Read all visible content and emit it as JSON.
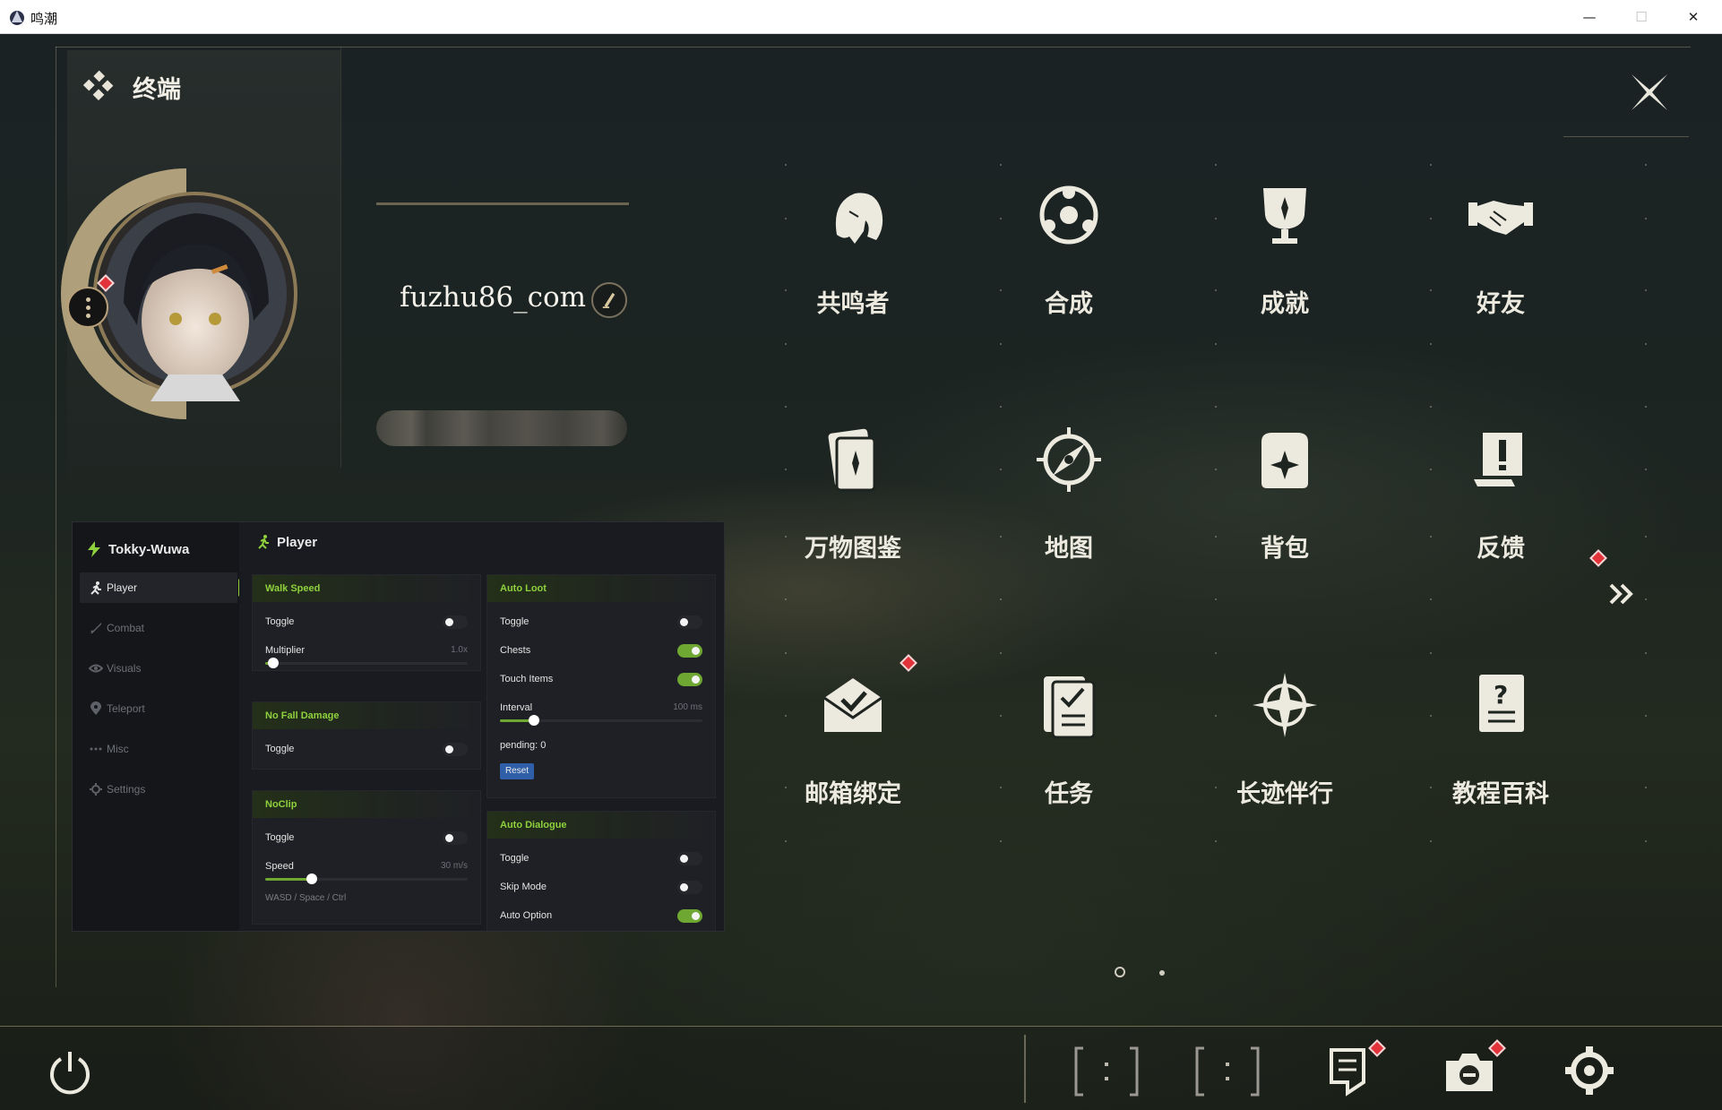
{
  "window": {
    "title": "鸣潮",
    "minimize": "—",
    "maximize": "☐",
    "close": "✕"
  },
  "header": {
    "title": "终端",
    "close_icon": "close-x-icon"
  },
  "profile": {
    "username": "fuzhu86_com"
  },
  "menu": {
    "items": [
      {
        "label": "共鸣者",
        "icon": "resonator-head-icon",
        "badge": false
      },
      {
        "label": "合成",
        "icon": "synthesis-icon",
        "badge": false
      },
      {
        "label": "成就",
        "icon": "trophy-icon",
        "badge": false
      },
      {
        "label": "好友",
        "icon": "handshake-icon",
        "badge": false
      },
      {
        "label": "万物图鉴",
        "icon": "card-book-icon",
        "badge": false
      },
      {
        "label": "地图",
        "icon": "compass-icon",
        "badge": false
      },
      {
        "label": "背包",
        "icon": "backpack-icon",
        "badge": false
      },
      {
        "label": "反馈",
        "icon": "feedback-icon",
        "badge": false
      },
      {
        "label": "邮箱绑定",
        "icon": "mail-bind-icon",
        "badge": true
      },
      {
        "label": "任务",
        "icon": "quest-icon",
        "badge": false
      },
      {
        "label": "长迹伴行",
        "icon": "star-sigil-icon",
        "badge": false
      },
      {
        "label": "教程百科",
        "icon": "tutorial-icon",
        "badge": false
      }
    ],
    "page": {
      "current": 1,
      "total": 2
    }
  },
  "bottom_bar": {
    "buttons": [
      "power-icon",
      "bracket-slot-icon",
      "bracket-slot-icon",
      "notes-icon",
      "camera-icon",
      "settings-gear-icon"
    ]
  },
  "overlay": {
    "brand": "Tokky-Wuwa",
    "nav": [
      {
        "label": "Player",
        "icon": "runner-icon",
        "active": true
      },
      {
        "label": "Combat",
        "icon": "sword-icon",
        "active": false
      },
      {
        "label": "Visuals",
        "icon": "eye-icon",
        "active": false
      },
      {
        "label": "Teleport",
        "icon": "pin-icon",
        "active": false
      },
      {
        "label": "Misc",
        "icon": "dots-icon",
        "active": false
      },
      {
        "label": "Settings",
        "icon": "gear-icon",
        "active": false
      }
    ],
    "page_title": "Player",
    "walk_speed": {
      "title": "Walk Speed",
      "toggle_label": "Toggle",
      "toggle": false,
      "multiplier_label": "Multiplier",
      "multiplier_value": "1.0x",
      "multiplier_fraction": 0.04
    },
    "no_fall_damage": {
      "title": "No Fall Damage",
      "toggle_label": "Toggle",
      "toggle": false
    },
    "noclip": {
      "title": "NoClip",
      "toggle_label": "Toggle",
      "toggle": false,
      "speed_label": "Speed",
      "speed_value": "30 m/s",
      "speed_fraction": 0.23,
      "hint": "WASD / Space / Ctrl"
    },
    "auto_loot": {
      "title": "Auto Loot",
      "toggle_label": "Toggle",
      "toggle": false,
      "chests_label": "Chests",
      "chests": true,
      "touch_label": "Touch Items",
      "touch": true,
      "interval_label": "Interval",
      "interval_value": "100 ms",
      "interval_fraction": 0.17,
      "pending": "pending: 0",
      "reset": "Reset"
    },
    "auto_dialogue": {
      "title": "Auto Dialogue",
      "toggle_label": "Toggle",
      "toggle": false,
      "skip_label": "Skip Mode",
      "skip": false,
      "auto_option_label": "Auto Option",
      "auto_option": true
    }
  },
  "colors": {
    "accent_green": "#8ed13d",
    "badge_red": "#e2333a",
    "gold": "#c8b48a",
    "reset_blue": "#2f5fa8"
  }
}
